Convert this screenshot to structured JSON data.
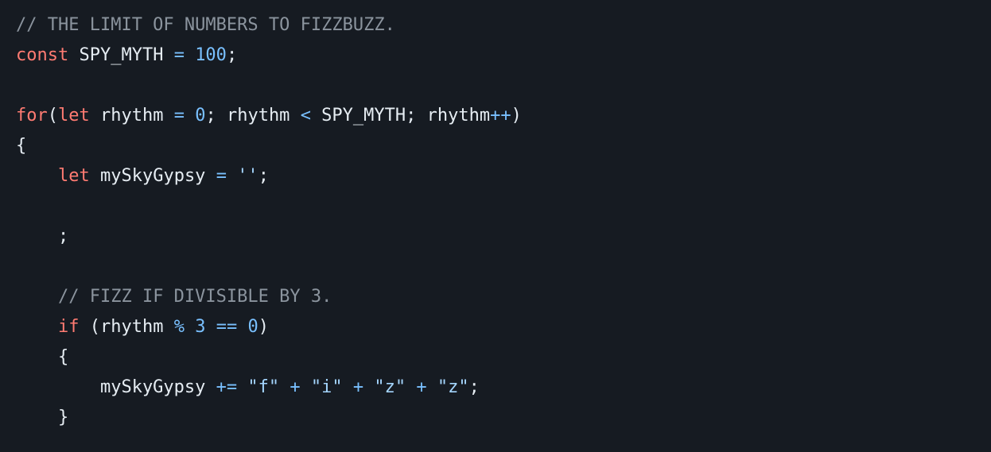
{
  "colors": {
    "background": "#161b22",
    "plain": "#e6edf3",
    "comment": "#8b949e",
    "keyword": "#ff7b72",
    "number": "#79c0ff",
    "operator": "#79c0ff",
    "string": "#a5d6ff"
  },
  "code": {
    "lines": [
      [
        {
          "t": "comment",
          "v": "// THE LIMIT OF NUMBERS TO FIZZBUZZ."
        }
      ],
      [
        {
          "t": "keyword",
          "v": "const"
        },
        {
          "t": "plain",
          "v": " SPY_MYTH "
        },
        {
          "t": "operator",
          "v": "="
        },
        {
          "t": "plain",
          "v": " "
        },
        {
          "t": "number",
          "v": "100"
        },
        {
          "t": "plain",
          "v": ";"
        }
      ],
      [],
      [
        {
          "t": "keyword",
          "v": "for"
        },
        {
          "t": "plain",
          "v": "("
        },
        {
          "t": "keyword",
          "v": "let"
        },
        {
          "t": "plain",
          "v": " rhythm "
        },
        {
          "t": "operator",
          "v": "="
        },
        {
          "t": "plain",
          "v": " "
        },
        {
          "t": "number",
          "v": "0"
        },
        {
          "t": "plain",
          "v": "; rhythm "
        },
        {
          "t": "operator",
          "v": "<"
        },
        {
          "t": "plain",
          "v": " SPY_MYTH; rhythm"
        },
        {
          "t": "operator",
          "v": "++"
        },
        {
          "t": "plain",
          "v": ")"
        }
      ],
      [
        {
          "t": "plain",
          "v": "{"
        }
      ],
      [
        {
          "t": "plain",
          "v": "    "
        },
        {
          "t": "keyword",
          "v": "let"
        },
        {
          "t": "plain",
          "v": " mySkyGypsy "
        },
        {
          "t": "operator",
          "v": "="
        },
        {
          "t": "plain",
          "v": " "
        },
        {
          "t": "string",
          "v": "''"
        },
        {
          "t": "plain",
          "v": ";"
        }
      ],
      [],
      [
        {
          "t": "plain",
          "v": "    ;"
        }
      ],
      [],
      [
        {
          "t": "plain",
          "v": "    "
        },
        {
          "t": "comment",
          "v": "// FIZZ IF DIVISIBLE BY 3."
        }
      ],
      [
        {
          "t": "plain",
          "v": "    "
        },
        {
          "t": "keyword",
          "v": "if"
        },
        {
          "t": "plain",
          "v": " (rhythm "
        },
        {
          "t": "operator",
          "v": "%"
        },
        {
          "t": "plain",
          "v": " "
        },
        {
          "t": "number",
          "v": "3"
        },
        {
          "t": "plain",
          "v": " "
        },
        {
          "t": "operator",
          "v": "=="
        },
        {
          "t": "plain",
          "v": " "
        },
        {
          "t": "number",
          "v": "0"
        },
        {
          "t": "plain",
          "v": ")"
        }
      ],
      [
        {
          "t": "plain",
          "v": "    {"
        }
      ],
      [
        {
          "t": "plain",
          "v": "        mySkyGypsy "
        },
        {
          "t": "operator",
          "v": "+="
        },
        {
          "t": "plain",
          "v": " "
        },
        {
          "t": "string",
          "v": "\"f\""
        },
        {
          "t": "plain",
          "v": " "
        },
        {
          "t": "operator",
          "v": "+"
        },
        {
          "t": "plain",
          "v": " "
        },
        {
          "t": "string",
          "v": "\"i\""
        },
        {
          "t": "plain",
          "v": " "
        },
        {
          "t": "operator",
          "v": "+"
        },
        {
          "t": "plain",
          "v": " "
        },
        {
          "t": "string",
          "v": "\"z\""
        },
        {
          "t": "plain",
          "v": " "
        },
        {
          "t": "operator",
          "v": "+"
        },
        {
          "t": "plain",
          "v": " "
        },
        {
          "t": "string",
          "v": "\"z\""
        },
        {
          "t": "plain",
          "v": ";"
        }
      ],
      [
        {
          "t": "plain",
          "v": "    }"
        }
      ]
    ]
  }
}
